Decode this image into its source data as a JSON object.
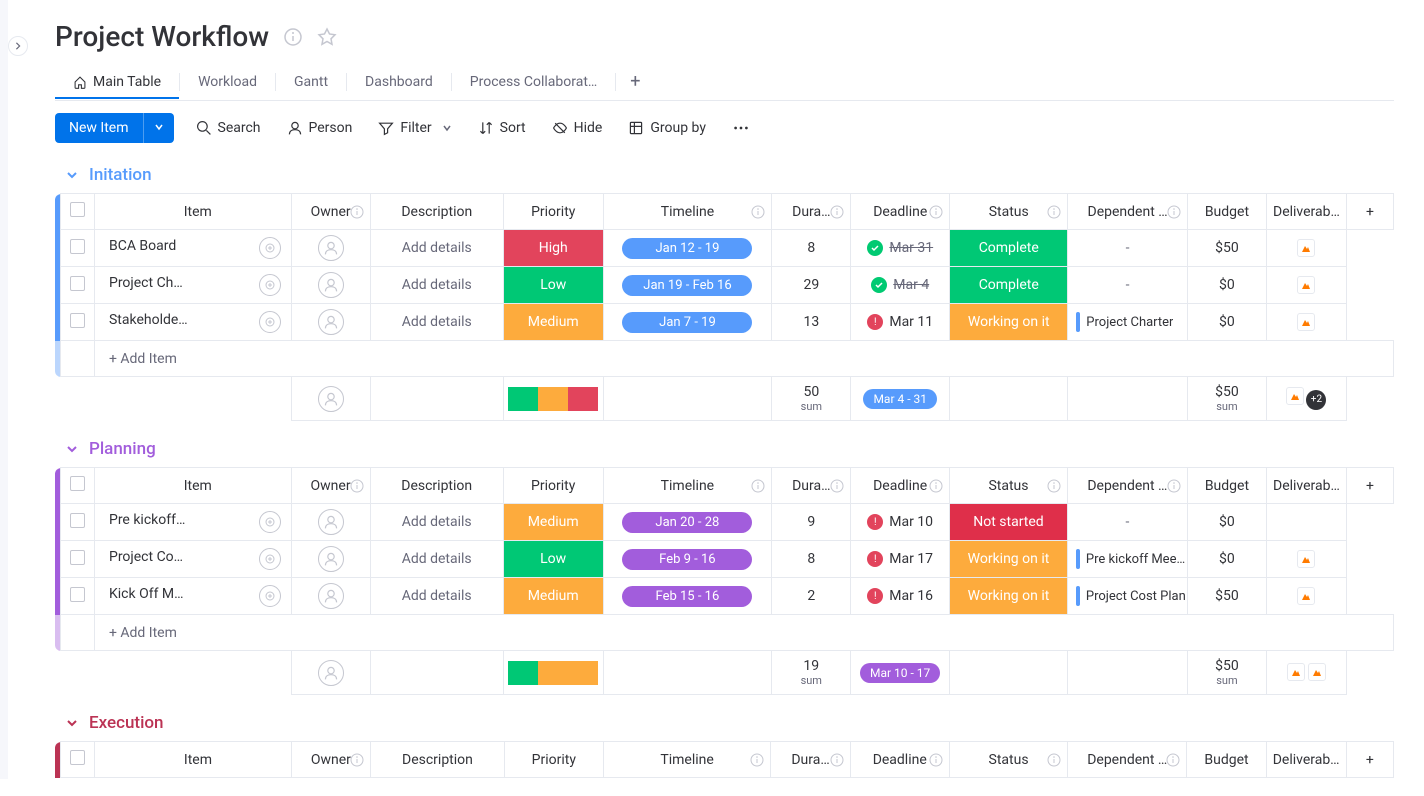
{
  "title": "Project Workflow",
  "tabs": [
    "Main Table",
    "Workload",
    "Gantt",
    "Dashboard",
    "Process Collaborat…"
  ],
  "activeTab": 0,
  "newItemLabel": "New Item",
  "toolbar": {
    "search": "Search",
    "person": "Person",
    "filter": "Filter",
    "sort": "Sort",
    "hide": "Hide",
    "groupby": "Group by"
  },
  "columns": {
    "item": "Item",
    "owner": "Owner",
    "description": "Description",
    "priority": "Priority",
    "timeline": "Timeline",
    "duration": "Dura…",
    "deadline": "Deadline",
    "status": "Status",
    "dependent": "Dependent …",
    "budget": "Budget",
    "deliverables": "Deliverab…"
  },
  "addItemLabel": "+ Add Item",
  "addDetailsLabel": "Add details",
  "sumLabel": "sum",
  "groups": [
    {
      "name": "Initation",
      "color": "#579bfc",
      "rows": [
        {
          "item": "BCA Board",
          "priority": "High",
          "priorityColor": "#e2445c",
          "timeline": "Jan 12 - 19",
          "timelineColor": "#579bfc",
          "duration": "8",
          "deadlineIcon": "check",
          "deadlineIconColor": "#00ca72",
          "deadline": "Mar 31",
          "deadlineStrike": true,
          "status": "Complete",
          "statusColor": "#00c875",
          "dependent": "-",
          "depBar": false,
          "budget": "$50",
          "doc": true
        },
        {
          "item": "Project Ch…",
          "priority": "Low",
          "priorityColor": "#00c875",
          "timeline": "Jan 19 - Feb 16",
          "timelineColor": "#579bfc",
          "duration": "29",
          "deadlineIcon": "check",
          "deadlineIconColor": "#00ca72",
          "deadline": "Mar 4",
          "deadlineStrike": true,
          "status": "Complete",
          "statusColor": "#00c875",
          "dependent": "-",
          "depBar": false,
          "budget": "$0",
          "doc": true
        },
        {
          "item": "Stakeholde…",
          "priority": "Medium",
          "priorityColor": "#fdab3d",
          "timeline": "Jan 7 - 19",
          "timelineColor": "#579bfc",
          "duration": "13",
          "deadlineIcon": "alert",
          "deadlineIconColor": "#e2445c",
          "deadline": "Mar 11",
          "deadlineStrike": false,
          "status": "Working on it",
          "statusColor": "#fdab3d",
          "dependent": "Project Charter",
          "depBar": true,
          "budget": "$0",
          "doc": true
        }
      ],
      "summary": {
        "durationSum": "50",
        "timelineRange": "Mar 4 - 31",
        "timelineColor": "#579bfc",
        "budgetSum": "$50",
        "prioritySegs": [
          "#00c875",
          "#fdab3d",
          "#e2445c"
        ],
        "docCount": "+2"
      }
    },
    {
      "name": "Planning",
      "color": "#a25ddc",
      "rows": [
        {
          "item": "Pre kickoff…",
          "priority": "Medium",
          "priorityColor": "#fdab3d",
          "timeline": "Jan 20 - 28",
          "timelineColor": "#a25ddc",
          "duration": "9",
          "deadlineIcon": "alert",
          "deadlineIconColor": "#e2445c",
          "deadline": "Mar 10",
          "deadlineStrike": false,
          "status": "Not started",
          "statusColor": "#df2f4a",
          "dependent": "-",
          "depBar": false,
          "budget": "$0",
          "doc": false
        },
        {
          "item": "Project Co…",
          "priority": "Low",
          "priorityColor": "#00c875",
          "timeline": "Feb 9 - 16",
          "timelineColor": "#a25ddc",
          "duration": "8",
          "deadlineIcon": "alert",
          "deadlineIconColor": "#e2445c",
          "deadline": "Mar 17",
          "deadlineStrike": false,
          "status": "Working on it",
          "statusColor": "#fdab3d",
          "dependent": "Pre kickoff Mee…",
          "depBar": true,
          "budget": "$0",
          "doc": true
        },
        {
          "item": "Kick Off M…",
          "priority": "Medium",
          "priorityColor": "#fdab3d",
          "timeline": "Feb 15 - 16",
          "timelineColor": "#a25ddc",
          "duration": "2",
          "deadlineIcon": "alert",
          "deadlineIconColor": "#e2445c",
          "deadline": "Mar 16",
          "deadlineStrike": false,
          "status": "Working on it",
          "statusColor": "#fdab3d",
          "dependent": "Project Cost Plan",
          "depBar": true,
          "budget": "$50",
          "doc": true
        }
      ],
      "summary": {
        "durationSum": "19",
        "timelineRange": "Mar 10 - 17",
        "timelineColor": "#a25ddc",
        "budgetSum": "$50",
        "prioritySegs": [
          "#00c875",
          "#fdab3d",
          "#fdab3d"
        ],
        "docCount": null,
        "docs": 2
      }
    },
    {
      "name": "Execution",
      "color": "#bb3354",
      "rows": [],
      "summary": null
    }
  ]
}
